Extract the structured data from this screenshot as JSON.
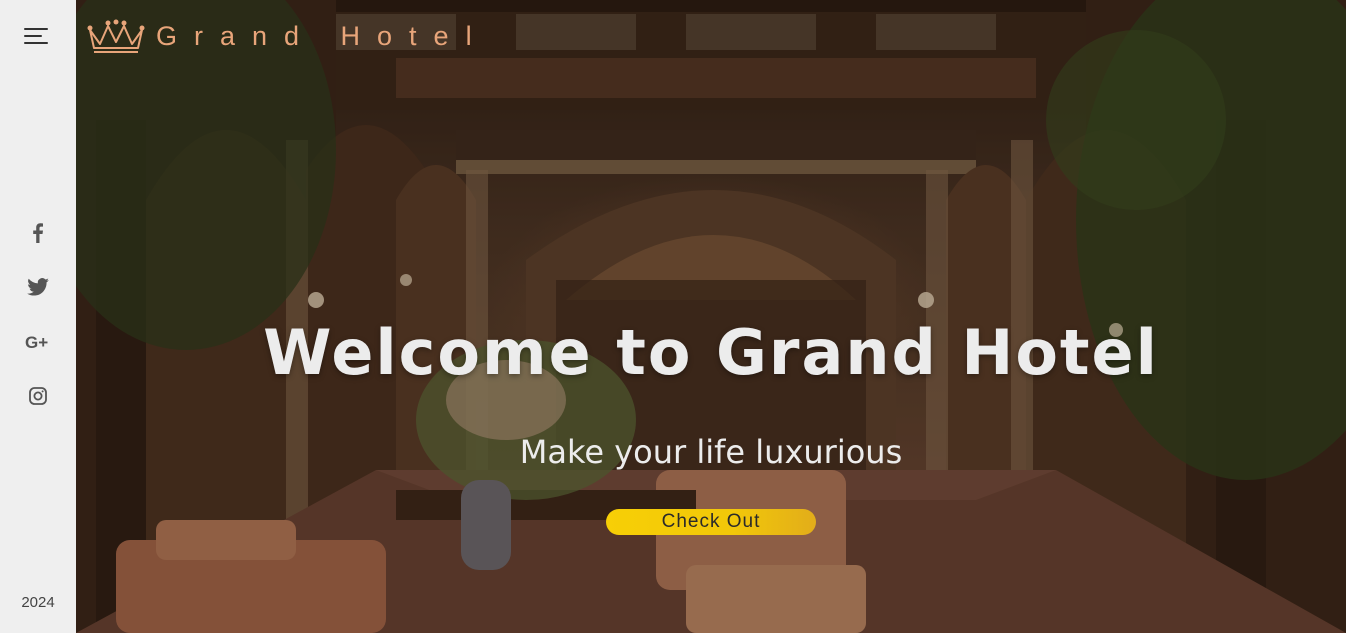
{
  "brand": {
    "name": "Grand Hotel",
    "icon": "crown-icon",
    "color": "#e8a57a"
  },
  "sidebar": {
    "menu_icon": "hamburger-menu-icon",
    "social": [
      {
        "name": "facebook-icon"
      },
      {
        "name": "twitter-icon"
      },
      {
        "name": "google-plus-icon"
      },
      {
        "name": "instagram-icon"
      }
    ],
    "year": "2024"
  },
  "hero": {
    "title": "Welcome to Grand Hotel",
    "subtitle": "Make your life luxurious",
    "cta_label": "Check Out",
    "cta_color": "#f7cf06"
  }
}
